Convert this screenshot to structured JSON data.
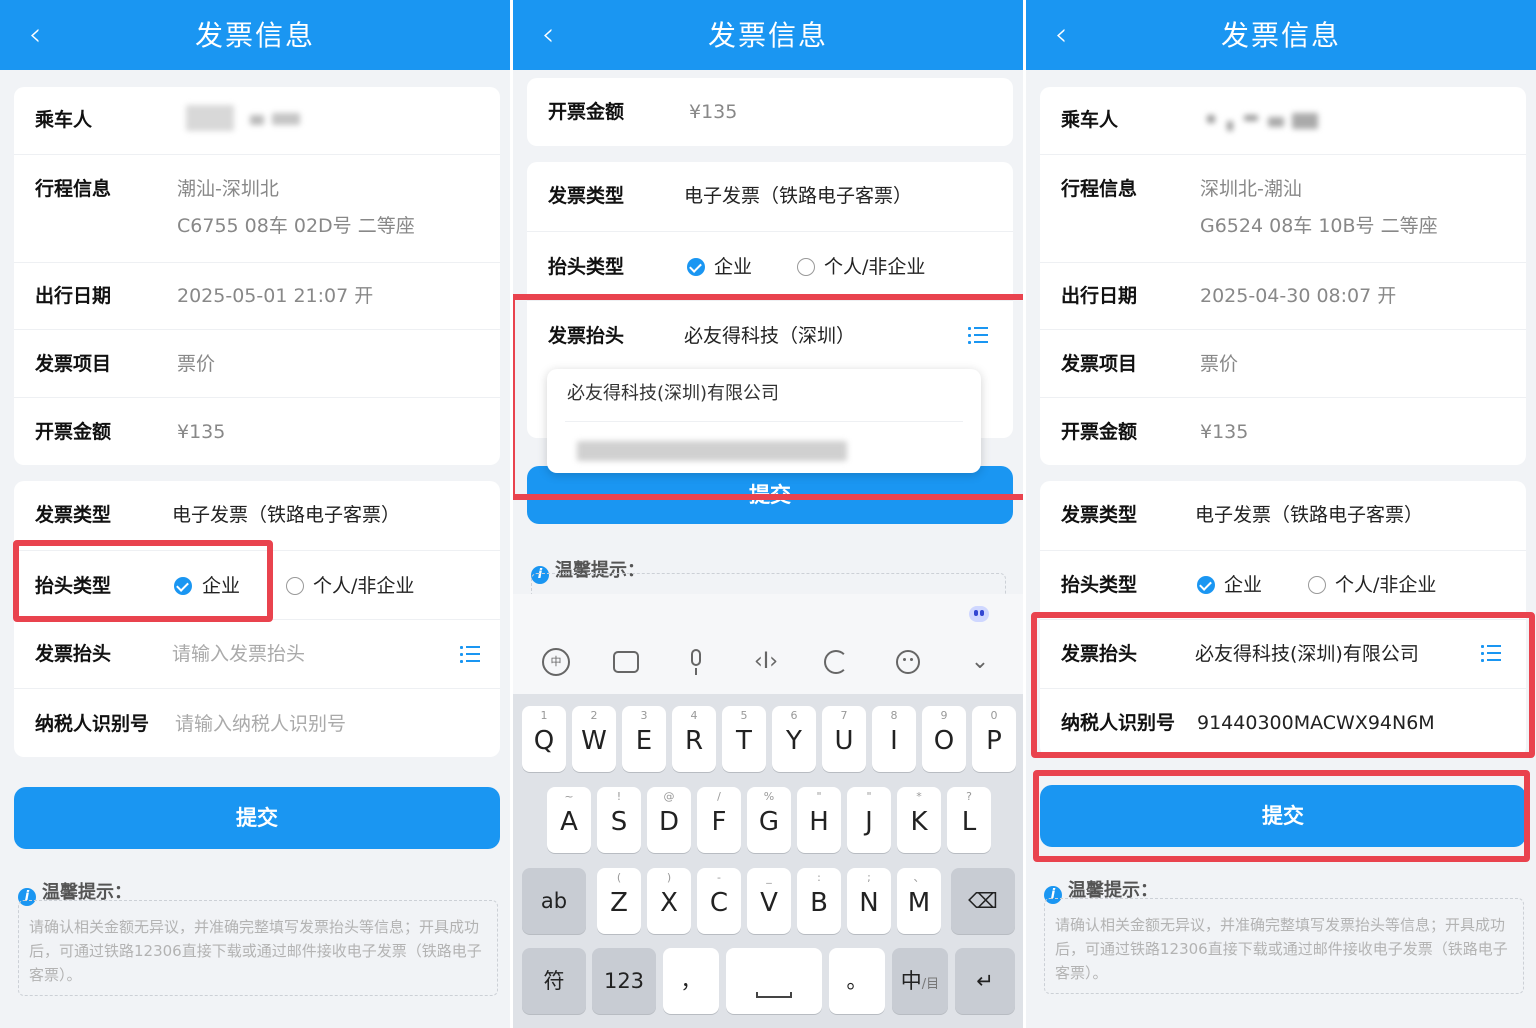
{
  "colors": {
    "accent": "#1a96f2",
    "highlight": "#e9434e"
  },
  "p1": {
    "back_icon": "‹",
    "title": "发票信息",
    "passenger_label": "乘车人",
    "trip_label": "行程信息",
    "trip_route": "潮汕-深圳北",
    "trip_detail": "C6755 08车 02D号 二等座",
    "date_label": "出行日期",
    "date_value": "2025-05-01 21:07 开",
    "item_label": "发票项目",
    "item_value": "票价",
    "amount_label": "开票金额",
    "amount_value": "¥135",
    "type_label": "发票类型",
    "type_value": "电子发票（铁路电子客票）",
    "header_type_label": "抬头类型",
    "option_company": "企业",
    "option_personal": "个人/非企业",
    "header_label": "发票抬头",
    "header_placeholder": "请输入发票抬头",
    "tax_label": "纳税人识别号",
    "tax_placeholder": "请输入纳税人识别号",
    "submit": "提交",
    "tip_title": "温馨提示：",
    "tip_text": "请确认相关金额无异议，并准确完整填写发票抬头等信息；开具成功后，可通过铁路12306直接下载或通过邮件接收电子发票（铁路电子客票）。"
  },
  "p2": {
    "back_icon": "‹",
    "title": "发票信息",
    "amount_label": "开票金额",
    "amount_value": "¥135",
    "type_label": "发票类型",
    "type_value": "电子发票（铁路电子客票）",
    "header_type_label": "抬头类型",
    "option_company": "企业",
    "option_personal": "个人/非企业",
    "header_label": "发票抬头",
    "header_value": "必友得科技（深圳）",
    "suggestion_1": "必友得科技(深圳)有限公司",
    "submit": "提交",
    "tip_title": "温馨提示：",
    "kb_icons": [
      "ime-icon",
      "keyboard-icon",
      "mic-icon",
      "cursor-icon",
      "ai-icon",
      "emoji-icon",
      "collapse-icon"
    ],
    "row1": [
      [
        "Q",
        "1"
      ],
      [
        "W",
        "2"
      ],
      [
        "E",
        "3"
      ],
      [
        "R",
        "4"
      ],
      [
        "T",
        "5"
      ],
      [
        "Y",
        "6"
      ],
      [
        "U",
        "7"
      ],
      [
        "I",
        "8"
      ],
      [
        "O",
        "9"
      ],
      [
        "P",
        "0"
      ]
    ],
    "row2": [
      [
        "A",
        "~"
      ],
      [
        "S",
        "!"
      ],
      [
        "D",
        "@"
      ],
      [
        "F",
        "/"
      ],
      [
        "G",
        "%"
      ],
      [
        "H",
        "\""
      ],
      [
        "J",
        "\""
      ],
      [
        "K",
        "*"
      ],
      [
        "L",
        "?"
      ]
    ],
    "row3": [
      [
        "Z",
        "("
      ],
      [
        "X",
        ")"
      ],
      [
        "C",
        "-"
      ],
      [
        "V",
        "_"
      ],
      [
        "B",
        ":"
      ],
      [
        "N",
        ";"
      ],
      [
        "M",
        "、"
      ]
    ],
    "key_ab": "ab",
    "key_symbol": "符",
    "key_123": "123",
    "key_comma": "，",
    "key_period": "。",
    "key_lang": "中",
    "key_lang_sub": "/目",
    "key_enter": "↵",
    "key_backspace": "⌫"
  },
  "p3": {
    "back_icon": "‹",
    "title": "发票信息",
    "passenger_label": "乘车人",
    "trip_label": "行程信息",
    "trip_route": "深圳北-潮汕",
    "trip_detail": "G6524 08车 10B号 二等座",
    "date_label": "出行日期",
    "date_value": "2025-04-30 08:07 开",
    "item_label": "发票项目",
    "item_value": "票价",
    "amount_label": "开票金额",
    "amount_value": "¥135",
    "type_label": "发票类型",
    "type_value": "电子发票（铁路电子客票）",
    "header_type_label": "抬头类型",
    "option_company": "企业",
    "option_personal": "个人/非企业",
    "header_label": "发票抬头",
    "header_value": "必友得科技(深圳)有限公司",
    "tax_label": "纳税人识别号",
    "tax_value": "91440300MACWX94N6M",
    "submit": "提交",
    "tip_title": "温馨提示：",
    "tip_text": "请确认相关金额无异议，并准确完整填写发票抬头等信息；开具成功后，可通过铁路12306直接下载或通过邮件接收电子发票（铁路电子客票）。"
  }
}
